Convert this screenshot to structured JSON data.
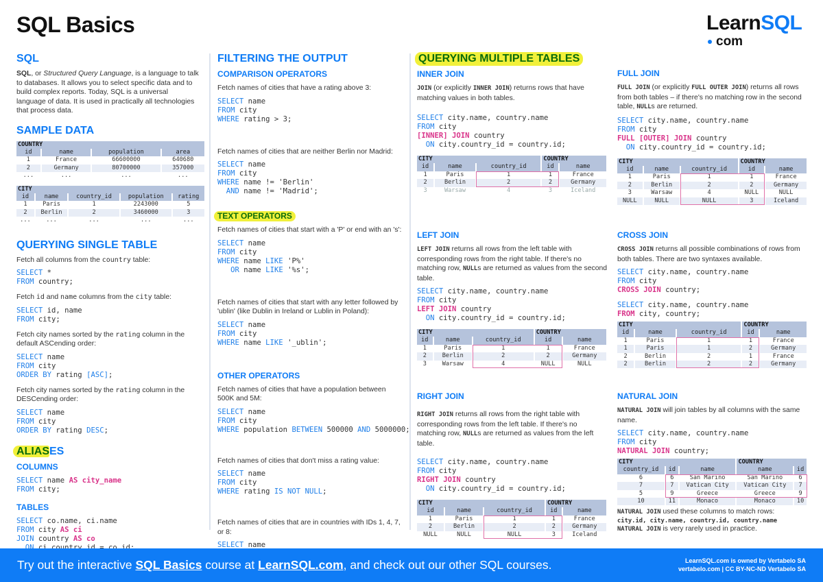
{
  "header": {
    "title": "SQL Basics",
    "logo_main": "Learn",
    "logo_accent": "SQL",
    "logo_sub": "com"
  },
  "sql": {
    "heading": "SQL",
    "intro_bold": "SQL",
    "intro_pre": ", or ",
    "intro_italic": "Structured Query Language",
    "intro_rest": ", is a language to talk to databases. It allows you to select specific data and to build complex reports. Today, SQL is a universal language of data. It is used in practically all technologies that process data."
  },
  "sample_data": {
    "heading": "SAMPLE DATA",
    "country": {
      "name": "COUNTRY",
      "columns": [
        "id",
        "name",
        "population",
        "area"
      ],
      "rows": [
        [
          "1",
          "France",
          "66600000",
          "640680"
        ],
        [
          "2",
          "Germany",
          "80700000",
          "357000"
        ],
        [
          "...",
          "...",
          "...",
          "..."
        ]
      ]
    },
    "city": {
      "name": "CITY",
      "columns": [
        "id",
        "name",
        "country_id",
        "population",
        "rating"
      ],
      "rows": [
        [
          "1",
          "Paris",
          "1",
          "2243000",
          "5"
        ],
        [
          "2",
          "Berlin",
          "2",
          "3460000",
          "3"
        ],
        [
          "...",
          "...",
          "...",
          "...",
          "..."
        ]
      ]
    }
  },
  "single_table": {
    "heading": "QUERYING SINGLE TABLE",
    "items": [
      {
        "desc_pre": "Fetch all columns from the ",
        "desc_code": "country",
        "desc_post": " table:"
      },
      {
        "desc_pre": "Fetch ",
        "desc_code": "id",
        "desc_mid": " and ",
        "desc_code2": "name",
        "desc_post2": " columns from the ",
        "desc_code3": "city",
        "desc_post": " table:"
      },
      {
        "desc_pre": "Fetch city names sorted by the ",
        "desc_code": "rating",
        "desc_post": " column in the default ASCending order:"
      },
      {
        "desc_pre": "Fetch city names sorted by the ",
        "desc_code": "rating",
        "desc_post": " column in the DESCending order:"
      }
    ]
  },
  "aliases": {
    "heading_hl": "ALIAS",
    "heading_rest": "ES",
    "columns_heading": "COLUMNS",
    "tables_heading": "TABLES"
  },
  "filtering": {
    "heading": "FILTERING THE OUTPUT",
    "comparison_heading": "COMPARISON OPERATORS",
    "text_heading": "TEXT OPERATORS",
    "other_heading": "OTHER OPERATORS",
    "descs": [
      "Fetch names of cities that have a rating above 3:",
      "Fetch names of cities that are neither Berlin nor Madrid:",
      "Fetch names of cities that start with a 'P' or end with an 's':",
      "Fetch names of cities that start with any letter followed by 'ublin' (like Dublin in Ireland or Lublin in Poland):",
      "Fetch names of cities that have a population between 500K and 5M:",
      "Fetch names of cities that don't miss a rating value:",
      "Fetch names of cities that are in countries with IDs 1, 4, 7, or 8:"
    ]
  },
  "multiple": {
    "heading": "QUERYING MULTIPLE TABLES",
    "inner": {
      "heading": "INNER JOIN",
      "k1": "JOIN",
      "t1": " (or explicitly ",
      "k2": "INNER JOIN",
      "t2": ") returns rows that have matching values in both tables."
    },
    "left": {
      "heading": "LEFT JOIN",
      "k1": "LEFT JOIN",
      "t1": " returns all rows from the left table with corresponding rows from the right table. If there's no matching row, ",
      "k2": "NULL",
      "t2": "s are returned as values from the second table."
    },
    "right": {
      "heading": "RIGHT JOIN",
      "k1": "RIGHT JOIN",
      "t1": " returns all rows from the right table with corresponding rows from the left table. If there's no matching row, ",
      "k2": "NULL",
      "t2": "s are returned as values from the left table."
    },
    "full": {
      "heading": "FULL JOIN",
      "k1": "FULL JOIN",
      "t1": " (or explicitly ",
      "k2": "FULL OUTER JOIN",
      "t2": ") returns all rows from both tables – if there's no matching row in the second table, ",
      "k3": "NULL",
      "t3": "s are returned."
    },
    "cross": {
      "heading": "CROSS JOIN",
      "k1": "CROSS JOIN",
      "t1": " returns all possible combinations of rows from both tables. There are two syntaxes available."
    },
    "natural": {
      "heading": "NATURAL JOIN",
      "k1": "NATURAL JOIN",
      "t1": " will join tables by all columns with the same name.",
      "note1_k": "NATURAL JOIN",
      "note1_t": " used these columns to match rows:",
      "note2": "city.id, city.name, country.id, country.name",
      "note3_k": "NATURAL JOIN",
      "note3_t": " is very rarely used in practice."
    },
    "table_labels": {
      "city": "CITY",
      "country": "COUNTRY"
    },
    "join_cols": [
      "id",
      "name",
      "country_id",
      "id",
      "name"
    ],
    "natural_cols": [
      "country_id",
      "id",
      "name",
      "name",
      "id"
    ],
    "tables": {
      "inner": [
        [
          "1",
          "Paris",
          "1",
          "1",
          "France"
        ],
        [
          "2",
          "Berlin",
          "2",
          "2",
          "Germany"
        ],
        [
          "3",
          "Warsaw",
          "4",
          "3",
          "Iceland"
        ]
      ],
      "left": [
        [
          "1",
          "Paris",
          "1",
          "1",
          "France"
        ],
        [
          "2",
          "Berlin",
          "2",
          "2",
          "Germany"
        ],
        [
          "3",
          "Warsaw",
          "4",
          "NULL",
          "NULL"
        ]
      ],
      "right": [
        [
          "1",
          "Paris",
          "1",
          "1",
          "France"
        ],
        [
          "2",
          "Berlin",
          "2",
          "2",
          "Germany"
        ],
        [
          "NULL",
          "NULL",
          "NULL",
          "3",
          "Iceland"
        ]
      ],
      "full": [
        [
          "1",
          "Paris",
          "1",
          "1",
          "France"
        ],
        [
          "2",
          "Berlin",
          "2",
          "2",
          "Germany"
        ],
        [
          "3",
          "Warsaw",
          "4",
          "NULL",
          "NULL"
        ],
        [
          "NULL",
          "NULL",
          "NULL",
          "3",
          "Iceland"
        ]
      ],
      "cross": [
        [
          "1",
          "Paris",
          "1",
          "1",
          "France"
        ],
        [
          "1",
          "Paris",
          "1",
          "2",
          "Germany"
        ],
        [
          "2",
          "Berlin",
          "2",
          "1",
          "France"
        ],
        [
          "2",
          "Berlin",
          "2",
          "2",
          "Germany"
        ]
      ],
      "natural": [
        [
          "6",
          "6",
          "San Marino",
          "San Marino",
          "6"
        ],
        [
          "7",
          "7",
          "Vatican City",
          "Vatican City",
          "7"
        ],
        [
          "5",
          "9",
          "Greece",
          "Greece",
          "9"
        ],
        [
          "10",
          "11",
          "Monaco",
          "Monaco",
          "10"
        ]
      ]
    }
  },
  "footer": {
    "cta_1": "Try out the interactive ",
    "cta_link1": "SQL Basics",
    "cta_2": " course at ",
    "cta_link2": "LearnSQL.com",
    "cta_3": ", and check out our other SQL courses.",
    "owner_1": "LearnSQL.com is owned by Vertabelo SA",
    "owner_2": "vertabelo.com | CC BY-NC-ND Vertabelo SA"
  },
  "colors": {
    "accent": "#0f7cf6",
    "keyword": "#1f7fe9",
    "join_keyword": "#d9348a",
    "highlight": "#f1f03a",
    "table_header": "#b5c3dc",
    "table_alt_row": "#e8edf6"
  }
}
